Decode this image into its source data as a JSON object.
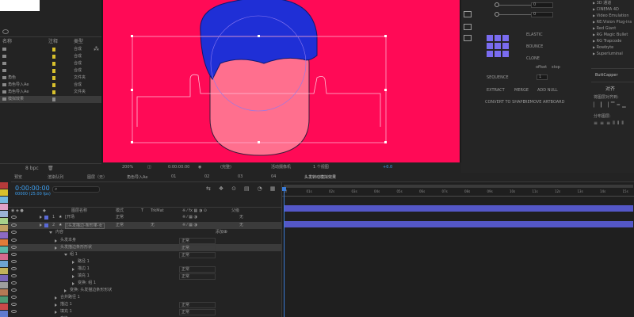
{
  "project_panel": {
    "columns": [
      "名称",
      "注释",
      "类型"
    ],
    "items": [
      {
        "name": "",
        "type": "合成"
      },
      {
        "name": "",
        "type": "合成"
      },
      {
        "name": "",
        "type": "合成"
      },
      {
        "name": "",
        "type": "合成"
      },
      {
        "name": "角色",
        "type": "文件夹"
      },
      {
        "name": "角色导入Ae",
        "type": "合成"
      },
      {
        "name": "角色导入Ae",
        "type": "文件夹"
      },
      {
        "name": "模拟效果",
        "type": ""
      }
    ],
    "bpc": "8 bpc"
  },
  "viewer": {
    "zoom": "200%",
    "timecode": "0:00:00:00",
    "resolution": "(完整)",
    "camera": "活动摄像机",
    "views": "1 个视图",
    "offset": "+0.0"
  },
  "effects_list": [
    "3D 通道",
    "CINEMA 4D",
    "Video Emulation",
    "RE:Vision Plug-ins",
    "Red Giant",
    "RG Magic Bullet",
    "RG Trapcode",
    "Rowbyte",
    "Superluminal"
  ],
  "motion_panel": {
    "values": [
      "0",
      "0"
    ],
    "buttons": {
      "elastic": "ELASTIC",
      "bounce": "BOUNCE",
      "clone": "CLONE",
      "offset": "offset",
      "stop": "stop",
      "sequence": "SEQUENCE",
      "extract": "EXTRACT",
      "merge": "MERGE",
      "add_null": "ADD NULL",
      "convert": "CONVERT TO SHAPE",
      "remove_artboard": "REMOVE ARTBOARD"
    },
    "sequence_value": "1"
  },
  "buttcapper": {
    "title": "ButtCapper",
    "align_title": "对齐",
    "align_label": "将图层对齐到:",
    "distribute_label": "分布图层:"
  },
  "timeline": {
    "tabs": [
      "预览",
      "渲染队列",
      "图层（无）",
      "角色导入Ae",
      "01",
      "02",
      "03",
      "04",
      "头发转动模拟效果"
    ],
    "timecode": "0:00:00:00",
    "fps": "00000 (25.00 fps)",
    "search_placeholder": "",
    "columns": {
      "name": "图层名称",
      "mode": "模式",
      "t": "T",
      "trkmat": "TrkMat",
      "parent": "父级"
    },
    "layers": [
      {
        "num": "1",
        "name": "[开场",
        "mode": "正常",
        "parent": "无"
      },
      {
        "num": "2",
        "name": "[头发描边-条形果-女",
        "mode": "正常",
        "trkmat": "无",
        "parent": "无"
      }
    ],
    "content_label": "内容",
    "add_label": "添加",
    "tree": [
      {
        "label": "头发本身",
        "mode": "正常"
      },
      {
        "label": "头发描边条形形状",
        "mode": "正常"
      },
      {
        "label": "组 1",
        "mode": "正常"
      },
      {
        "label": "路径 1",
        "mode": ""
      },
      {
        "label": "描边 1",
        "mode": "正常"
      },
      {
        "label": "填充 1",
        "mode": "正常"
      },
      {
        "label": "变换: 组 1",
        "mode": ""
      },
      {
        "label": "变换: 头发描边条形形状",
        "mode": ""
      },
      {
        "label": "合并路径 1",
        "mode": ""
      },
      {
        "label": "描边 1",
        "mode": "正常"
      },
      {
        "label": "填充 1",
        "mode": "正常"
      },
      {
        "label": "变换",
        "mode": ""
      }
    ],
    "ruler": [
      "0f",
      "01s",
      "02s",
      "03s",
      "04s",
      "05s",
      "06s",
      "07s",
      "08s",
      "09s",
      "10s",
      "11s",
      "12s",
      "13s",
      "14s",
      "15s"
    ]
  },
  "colors": {
    "comp_bg": "#ff0a56",
    "hair": "#1f2fd6",
    "face": "#ff6f8e",
    "layer_bar": "#5457c7",
    "accent": "#3ea1f2",
    "label_colors": [
      "#d8c02c",
      "#d8c02c",
      "#d8c02c",
      "#d8c02c",
      "#d8c02c",
      "#d8c02c",
      "#d8c02c",
      "#8d8d8d"
    ],
    "sidebar_colors": [
      "#b53a3a",
      "#d8c02c",
      "#74b8de",
      "#e0a2c8",
      "#9ab3d6",
      "#a8d18b",
      "#c2a163",
      "#8d6ac2",
      "#e07b39",
      "#5ab7a8",
      "#d66a8e",
      "#6da3d1",
      "#c2b25a",
      "#7a66b8",
      "#9e9e9e",
      "#b57a55",
      "#4e9a74",
      "#c94949",
      "#5f7ccf",
      "#a36a3c"
    ]
  }
}
